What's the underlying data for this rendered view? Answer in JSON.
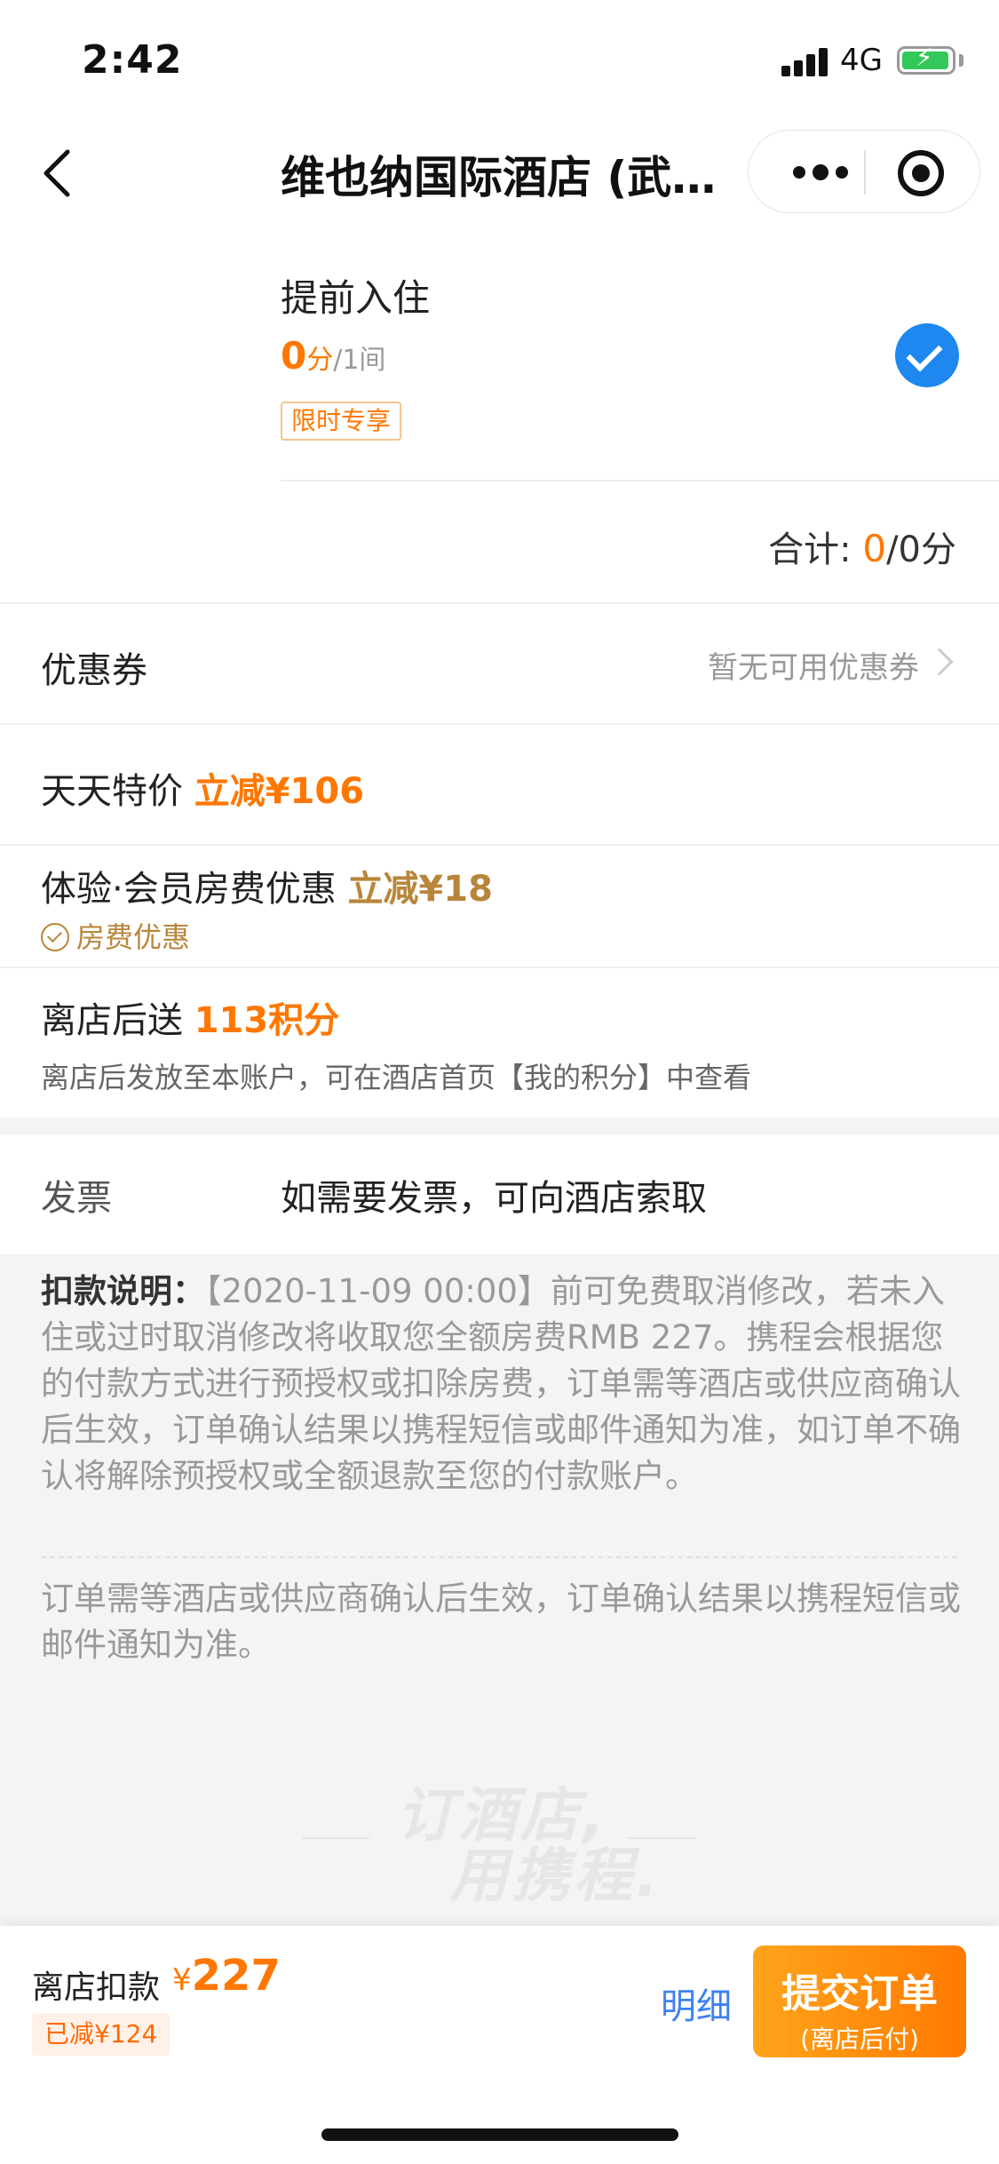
{
  "status_bar": {
    "time": "2:42",
    "network": "4G",
    "battery_charging": true
  },
  "nav": {
    "title": "维也纳国际酒店 (武…",
    "back_icon": "chevron-left-icon",
    "more_icon": "more-dots-icon",
    "close_icon": "target-close-icon"
  },
  "early_checkin": {
    "title": "提前入住",
    "price": "0",
    "unit": "分",
    "per": "/1间",
    "tag": "限时专享",
    "selected": true
  },
  "total": {
    "label": "合计:",
    "value": "0",
    "unit": "/0分"
  },
  "coupon": {
    "label": "优惠券",
    "value": "暂无可用优惠券"
  },
  "daily_special": {
    "label": "天天特价",
    "discount": "立减¥106"
  },
  "member": {
    "label": "体验·会员房费优惠",
    "discount": "立减¥18",
    "tag": "房费优惠"
  },
  "points": {
    "label": "离店后送",
    "value": "113积分",
    "note": "离店后发放至本账户，可在酒店首页【我的积分】中查看"
  },
  "invoice": {
    "label": "发票",
    "value": "如需要发票，可向酒店索取"
  },
  "deduction": {
    "label": "扣款说明：",
    "text": "【2020-11-09 00:00】前可免费取消修改，若未入住或过时取消修改将收取您全额房费RMB 227。携程会根据您的付款方式进行预授权或扣除房费，订单需等酒店或供应商确认后生效，订单确认结果以携程短信或邮件通知为准，如订单不确认将解除预授权或全额退款至您的付款账户。"
  },
  "confirm_note": "订单需等酒店或供应商确认后生效，订单确认结果以携程短信或邮件通知为准。",
  "watermark": {
    "line1": "订酒店,",
    "line2": "用携程."
  },
  "bottom": {
    "pay_label": "离店扣款",
    "currency": "¥",
    "amount": "227",
    "reduced": "已减¥124",
    "detail": "明细",
    "submit": "提交订单",
    "submit_sub": "(离店后付)"
  },
  "colors": {
    "accent": "#ff7700",
    "blue": "#1e88f0",
    "gold": "#b8863b",
    "link": "#3d82f0"
  }
}
